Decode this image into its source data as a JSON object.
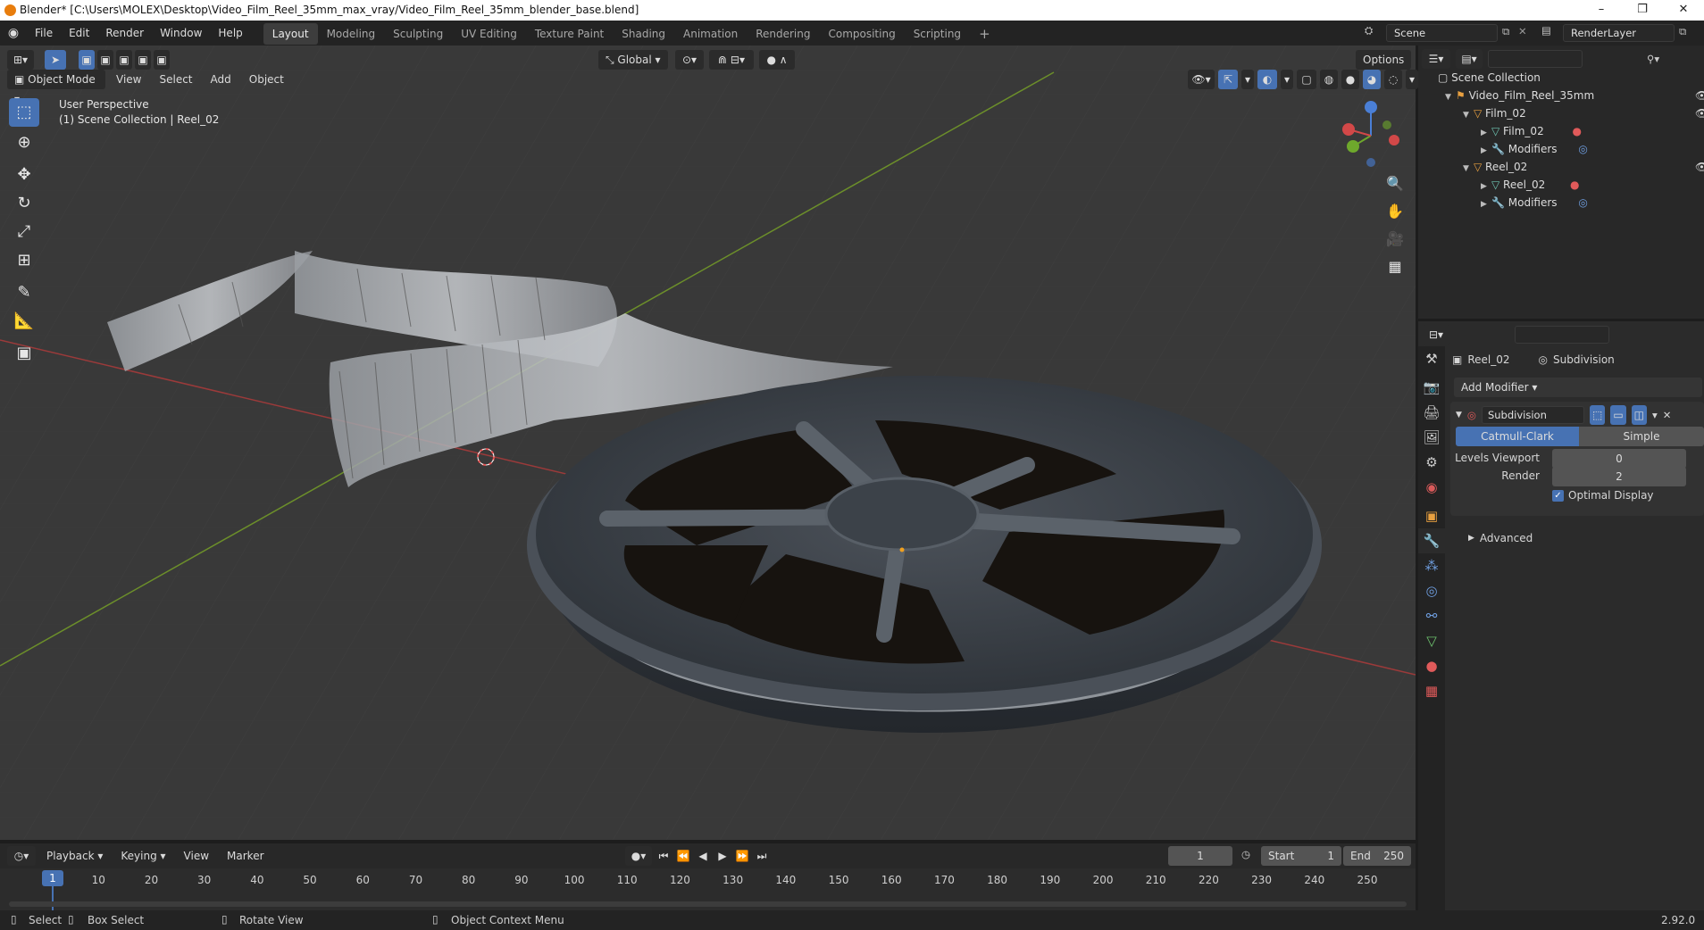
{
  "window": {
    "title": "Blender* [C:\\Users\\MOLEX\\Desktop\\Video_Film_Reel_35mm_max_vray/Video_Film_Reel_35mm_blender_base.blend]"
  },
  "menu": [
    "File",
    "Edit",
    "Render",
    "Window",
    "Help"
  ],
  "workspaces": [
    "Layout",
    "Modeling",
    "Sculpting",
    "UV Editing",
    "Texture Paint",
    "Shading",
    "Animation",
    "Rendering",
    "Compositing",
    "Scripting"
  ],
  "active_workspace": "Layout",
  "scene": "Scene",
  "render_layer": "RenderLayer",
  "viewport": {
    "mode": "Object Mode",
    "menus": [
      "View",
      "Select",
      "Add",
      "Object"
    ],
    "transform_orientation": "Global",
    "options_label": "Options",
    "perspective": "User Perspective",
    "collection_info": "(1) Scene Collection | Reel_02"
  },
  "outliner": {
    "root": "Scene Collection",
    "items": [
      {
        "label": "Video_Film_Reel_35mm"
      },
      {
        "label": "Film_02"
      },
      {
        "label": "Film_02"
      },
      {
        "label": "Modifiers"
      },
      {
        "label": "Reel_02"
      },
      {
        "label": "Reel_02"
      },
      {
        "label": "Modifiers"
      }
    ]
  },
  "properties": {
    "object_name": "Reel_02",
    "modifier_context": "Subdivision",
    "add_modifier": "Add Modifier",
    "modifier_name": "Subdivision",
    "method_catmull": "Catmull-Clark",
    "method_simple": "Simple",
    "levels_viewport_label": "Levels Viewport",
    "levels_viewport_value": "0",
    "render_label": "Render",
    "render_value": "2",
    "optimal_display": "Optimal Display",
    "advanced": "Advanced"
  },
  "timeline": {
    "menus": [
      "Playback",
      "Keying",
      "View",
      "Marker"
    ],
    "current_frame": "1",
    "start_label": "Start",
    "start_value": "1",
    "end_label": "End",
    "end_value": "250",
    "ticks": [
      "1",
      "10",
      "20",
      "30",
      "40",
      "50",
      "60",
      "70",
      "80",
      "90",
      "100",
      "110",
      "120",
      "130",
      "140",
      "150",
      "160",
      "170",
      "180",
      "190",
      "200",
      "210",
      "220",
      "230",
      "240",
      "250"
    ]
  },
  "statusbar": {
    "select": "Select",
    "box_select": "Box Select",
    "rotate_view": "Rotate View",
    "context_menu": "Object Context Menu",
    "version": "2.92.0"
  }
}
